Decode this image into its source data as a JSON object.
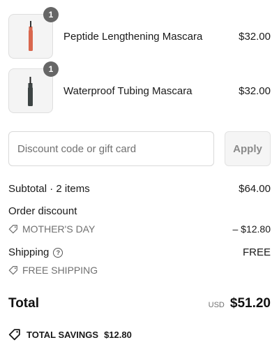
{
  "line_items": [
    {
      "name": "Peptide Lengthening Mascara",
      "price": "$32.00",
      "quantity": "1",
      "color": "#d9674e"
    },
    {
      "name": "Waterproof Tubing Mascara",
      "price": "$32.00",
      "quantity": "1",
      "color": "#3d4444"
    }
  ],
  "discount": {
    "placeholder": "Discount code or gift card",
    "apply_label": "Apply"
  },
  "summary": {
    "subtotal_label": "Subtotal · 2 items",
    "subtotal_value": "$64.00",
    "order_discount_label": "Order discount",
    "order_discount_code": "MOTHER'S DAY",
    "order_discount_value": "– $12.80",
    "shipping_label": "Shipping",
    "shipping_value": "FREE",
    "shipping_discount_code": "FREE SHIPPING",
    "total_label": "Total",
    "currency": "USD",
    "total_value": "$51.20",
    "savings_label": "TOTAL SAVINGS",
    "savings_value": "$12.80"
  }
}
